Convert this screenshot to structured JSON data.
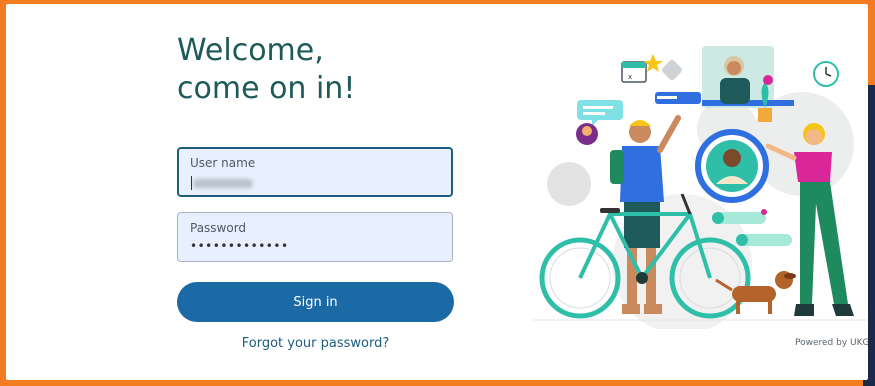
{
  "heading": {
    "line1": "Welcome,",
    "line2": "come on in!"
  },
  "username": {
    "label": "User name",
    "value": "jsmith.nu"
  },
  "password": {
    "label": "Password",
    "value": "•••••••••••••"
  },
  "signin": {
    "label": "Sign in"
  },
  "forgot": {
    "label": "Forgot your password?"
  },
  "footer": {
    "powered": "Powered by UKG"
  },
  "colors": {
    "frame": "#f47c20",
    "heading": "#1f5a5a",
    "button": "#1b6aa5",
    "link": "#1b5e7e",
    "field_bg": "#e8f0fd"
  },
  "icons": [
    "calendar-icon",
    "star-icon",
    "clock-icon",
    "chat-bubble-icon",
    "plant-icon",
    "bicycle-icon",
    "dog-icon"
  ]
}
